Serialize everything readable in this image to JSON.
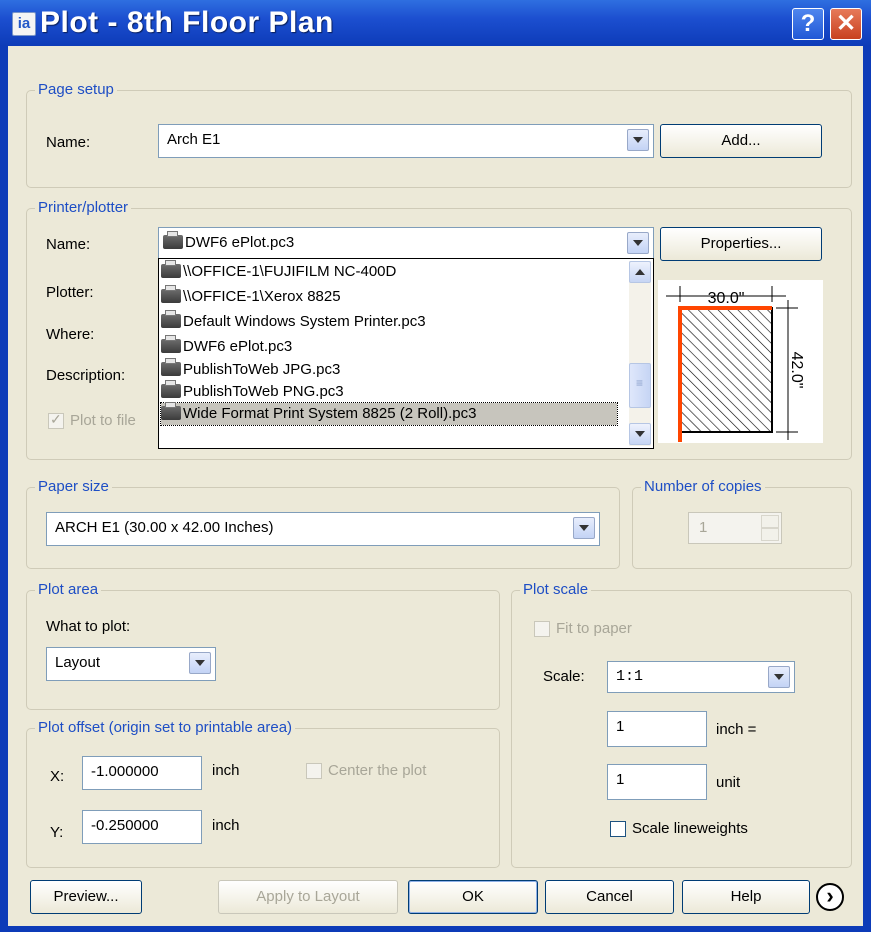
{
  "window": {
    "title": "Plot - 8th Floor Plan",
    "help_glyph": "?",
    "close_glyph": "✕",
    "app_icon": "ia"
  },
  "page_setup": {
    "legend": "Page setup",
    "name_label": "Name:",
    "name_value": "Arch E1",
    "add_button": "Add..."
  },
  "printer": {
    "legend": "Printer/plotter",
    "name_label": "Name:",
    "name_value": "DWF6 ePlot.pc3",
    "properties_button": "Properties...",
    "plotter_label": "Plotter:",
    "where_label": "Where:",
    "description_label": "Description:",
    "plot_to_file_label": "Plot to file",
    "dropdown_items": [
      "\\\\OFFICE-1\\FUJIFILM NC-400D",
      "\\\\OFFICE-1\\Xerox 8825",
      "Default Windows System Printer.pc3",
      "DWF6 ePlot.pc3",
      "PublishToWeb JPG.pc3",
      "PublishToWeb PNG.pc3",
      "Wide Format Print System 8825 (2 Roll).pc3"
    ],
    "preview_width": "30.0\"",
    "preview_height": "42.0\""
  },
  "paper_size": {
    "legend": "Paper size",
    "value": "ARCH E1 (30.00 x 42.00 Inches)"
  },
  "copies": {
    "legend": "Number of copies",
    "value": "1"
  },
  "plot_area": {
    "legend": "Plot area",
    "what_label": "What to plot:",
    "value": "Layout"
  },
  "plot_offset": {
    "legend": "Plot offset (origin set to printable area)",
    "x_label": "X:",
    "x_value": "-1.000000",
    "x_unit": "inch",
    "y_label": "Y:",
    "y_value": "-0.250000",
    "y_unit": "inch",
    "center_label": "Center the plot"
  },
  "plot_scale": {
    "legend": "Plot scale",
    "fit_label": "Fit to paper",
    "scale_label": "Scale:",
    "scale_value": "1:1",
    "inch_value": "1",
    "inch_label": "inch =",
    "unit_value": "1",
    "unit_label": "unit",
    "lineweights_label": "Scale lineweights"
  },
  "buttons": {
    "preview": "Preview...",
    "apply": "Apply to Layout",
    "ok": "OK",
    "cancel": "Cancel",
    "help": "Help",
    "more_glyph": "›"
  },
  "colors": {
    "legend_blue": "#1e4ec5",
    "selection": "#c7c5bd",
    "paper_edge": "#ff4500",
    "dialog_bg": "#ece9d8"
  }
}
